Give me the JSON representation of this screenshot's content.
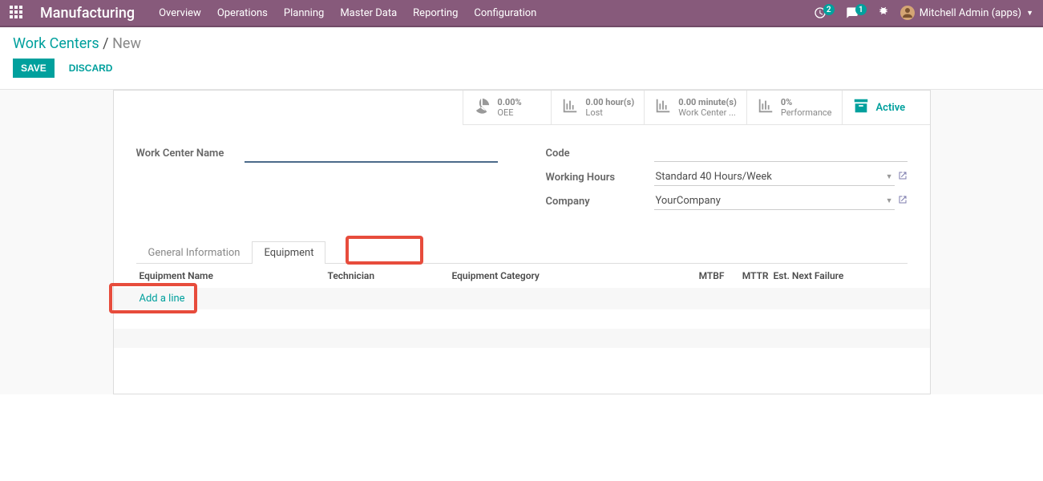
{
  "topbar": {
    "brand": "Manufacturing",
    "menu": [
      "Overview",
      "Operations",
      "Planning",
      "Master Data",
      "Reporting",
      "Configuration"
    ],
    "notif1_count": "2",
    "notif2_count": "1",
    "user": "Mitchell Admin (apps)"
  },
  "breadcrumb": {
    "parent": "Work Centers",
    "sep": "/",
    "current": "New"
  },
  "buttons": {
    "save": "SAVE",
    "discard": "DISCARD"
  },
  "stats": {
    "oee_val": "0.00%",
    "oee_lbl": "OEE",
    "lost_val": "0.00 hour(s)",
    "lost_lbl": "Lost",
    "load_val": "0.00 minute(s)",
    "load_lbl": "Work Center ...",
    "perf_val": "0%",
    "perf_lbl": "Performance",
    "active": "Active"
  },
  "form": {
    "name_label": "Work Center Name",
    "name_value": "",
    "code_label": "Code",
    "code_value": "",
    "hours_label": "Working Hours",
    "hours_value": "Standard 40 Hours/Week",
    "company_label": "Company",
    "company_value": "YourCompany"
  },
  "tabs": {
    "general": "General Information",
    "equipment": "Equipment"
  },
  "table": {
    "col_name": "Equipment Name",
    "col_tech": "Technician",
    "col_cat": "Equipment Category",
    "col_mtbf": "MTBF",
    "col_mttr": "MTTR",
    "col_next": "Est. Next Failure",
    "add": "Add a line"
  }
}
